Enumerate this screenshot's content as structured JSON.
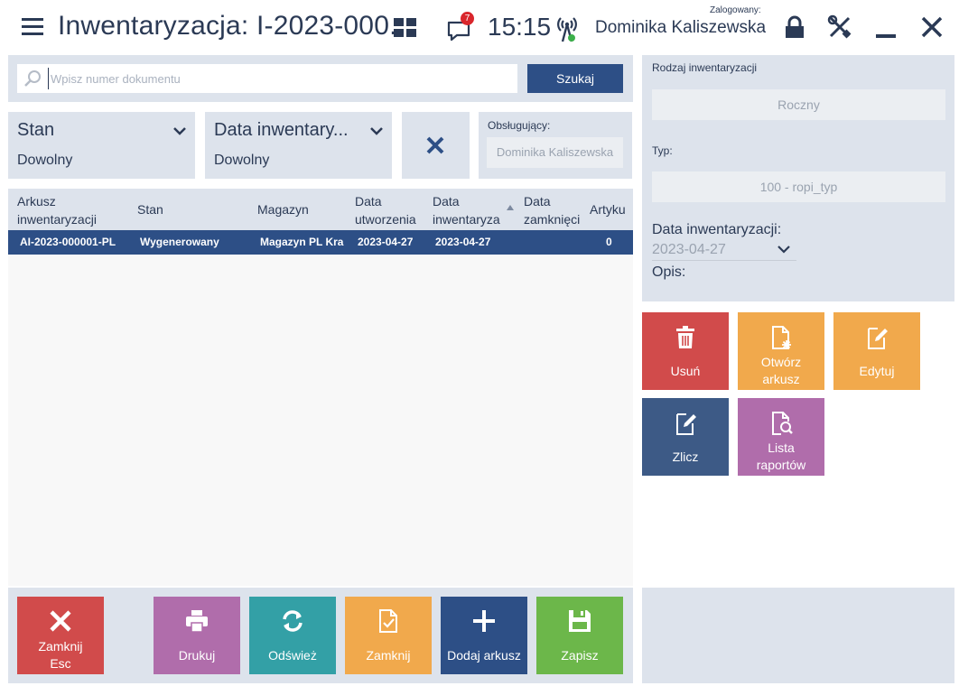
{
  "header": {
    "title": "Inwentaryzacja: I-2023-000...",
    "notification_count": "7",
    "time": "15:15",
    "logged_label": "Zalogowany:",
    "user_name": "Dominika Kaliszewska"
  },
  "search": {
    "placeholder": "Wpisz numer dokumentu",
    "value": "",
    "button_label": "Szukaj"
  },
  "filters": {
    "stan": {
      "label": "Stan",
      "value": "Dowolny"
    },
    "data": {
      "label": "Data inwentary...",
      "value": "Dowolny"
    },
    "obslugujacy": {
      "label": "Obsługujący:",
      "value": "Dominika Kaliszewska"
    }
  },
  "table": {
    "columns": [
      {
        "line1": "Arkusz",
        "line2": "inwentaryzacji"
      },
      {
        "line1": "Stan",
        "line2": ""
      },
      {
        "line1": "Magazyn",
        "line2": ""
      },
      {
        "line1": "Data",
        "line2": "utworzenia"
      },
      {
        "line1": "Data",
        "line2": "inwentaryza"
      },
      {
        "line1": "Data",
        "line2": "zamknięci"
      },
      {
        "line1": "Artyku",
        "line2": ""
      }
    ],
    "rows": [
      [
        "AI-2023-000001-PL",
        "Wygenerowany",
        "Magazyn PL Krak",
        "2023-04-27",
        "2023-04-27",
        "",
        "0"
      ]
    ]
  },
  "details": {
    "rodzaj_label": "Rodzaj inwentaryzacji",
    "rodzaj_value": "Roczny",
    "typ_label": "Typ:",
    "typ_value": "100 - ropi_typ",
    "data_label": "Data inwentaryzacji:",
    "data_value": "2023-04-27",
    "opis_label": "Opis:"
  },
  "actions": {
    "usun": "Usuń",
    "otworz_1": "Otwórz",
    "otworz_2": "arkusz",
    "edytuj": "Edytuj",
    "zlicz": "Zlicz",
    "lista_1": "Lista",
    "lista_2": "raportów"
  },
  "bottom": {
    "zamknij_esc_1": "Zamknij",
    "zamknij_esc_2": "Esc",
    "drukuj": "Drukuj",
    "odswiez": "Odśwież",
    "zamknij": "Zamknij",
    "dodaj": "Dodaj arkusz",
    "zapisz": "Zapisz"
  },
  "colors": {
    "accent": "#2d4f86",
    "panel": "#dde3ec",
    "red": "#d14b4b",
    "orange": "#f1a94c",
    "purple": "#b06dab",
    "teal": "#33a0a6",
    "green": "#6cb74a"
  },
  "icons": [
    "hamburger-icon",
    "grid-icon",
    "message-icon",
    "signal-icon",
    "lock-icon",
    "tools-icon",
    "minimize-icon",
    "close-icon",
    "search-icon",
    "chevron-down-icon",
    "clear-icon",
    "trash-icon",
    "open-sheet-icon",
    "edit-icon",
    "count-icon",
    "report-list-icon",
    "close-x-icon",
    "print-icon",
    "refresh-icon",
    "close-document-icon",
    "plus-icon",
    "save-icon"
  ]
}
